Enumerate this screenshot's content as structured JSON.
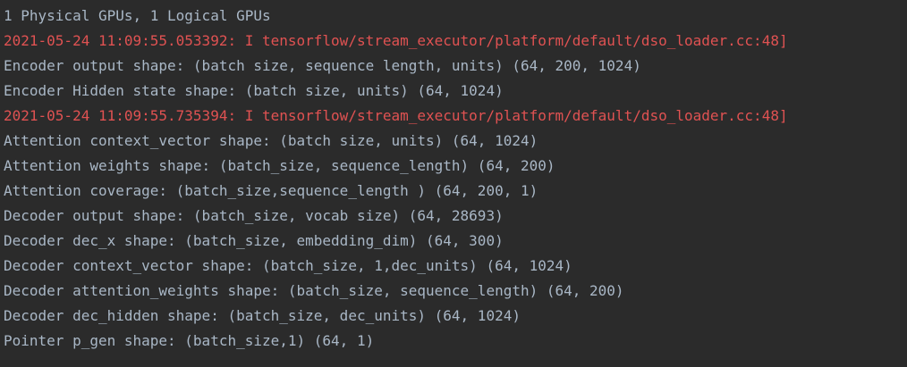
{
  "console": {
    "lines": [
      {
        "text": "1 Physical GPUs, 1 Logical GPUs",
        "type": "stdout"
      },
      {
        "text": "2021-05-24 11:09:55.053392: I tensorflow/stream_executor/platform/default/dso_loader.cc:48]",
        "type": "stderr"
      },
      {
        "text": "Encoder output shape: (batch size, sequence length, units) (64, 200, 1024)",
        "type": "stdout"
      },
      {
        "text": "Encoder Hidden state shape: (batch size, units) (64, 1024)",
        "type": "stdout"
      },
      {
        "text": "2021-05-24 11:09:55.735394: I tensorflow/stream_executor/platform/default/dso_loader.cc:48]",
        "type": "stderr"
      },
      {
        "text": "Attention context_vector shape: (batch size, units) (64, 1024)",
        "type": "stdout"
      },
      {
        "text": "Attention weights shape: (batch_size, sequence_length) (64, 200)",
        "type": "stdout"
      },
      {
        "text": "Attention coverage: (batch_size,sequence_length ) (64, 200, 1)",
        "type": "stdout"
      },
      {
        "text": "Decoder output shape: (batch_size, vocab size) (64, 28693)",
        "type": "stdout"
      },
      {
        "text": "Decoder dec_x shape: (batch_size, embedding_dim) (64, 300)",
        "type": "stdout"
      },
      {
        "text": "Decoder context_vector shape: (batch_size, 1,dec_units) (64, 1024)",
        "type": "stdout"
      },
      {
        "text": "Decoder attention_weights shape: (batch_size, sequence_length) (64, 200)",
        "type": "stdout"
      },
      {
        "text": "Decoder dec_hidden shape: (batch_size, dec_units) (64, 1024)",
        "type": "stdout"
      },
      {
        "text": "Pointer p_gen shape: (batch_size,1) (64, 1)",
        "type": "stdout"
      }
    ]
  },
  "colors": {
    "background": "#2b2b2b",
    "stdout": "#a9b7c6",
    "stderr": "#e05252"
  }
}
